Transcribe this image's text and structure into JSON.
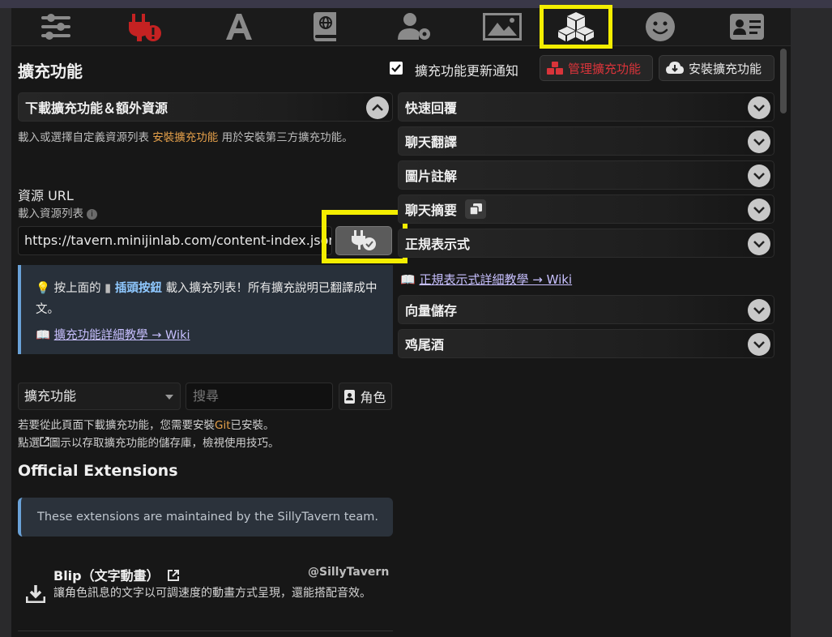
{
  "nav": {
    "icons": [
      "sliders-icon",
      "plug-error-icon",
      "font-a-icon",
      "book-globe-icon",
      "user-gear-icon",
      "image-icon",
      "cubes-icon",
      "smiley-icon",
      "id-card-icon"
    ],
    "active": "cubes-icon"
  },
  "header": {
    "title": "擴充功能",
    "notify_label": "擴充功能更新通知",
    "manage_label": "管理擴充功能",
    "install_label": "安裝擴充功能"
  },
  "download": {
    "title": "下載擴充功能＆額外資源",
    "desc_before": "載入或選擇自定義資源列表",
    "desc_link": "安裝擴充功能",
    "desc_after": "用於安裝第三方擴充功能。",
    "url_label": "資源 URL",
    "list_label": "載入資源列表",
    "url_value": "https://tavern.minijinlab.com/content-index.json"
  },
  "info": {
    "line_a": "按上面的",
    "line_b": "插頭按鈕",
    "line_c": "載入擴充列表！所有擴充說明已翻譯成中文。",
    "wiki": "擴充功能詳細教學 → Wiki"
  },
  "filter": {
    "select_value": "擴充功能",
    "search_placeholder": "搜尋",
    "role_label": "角色"
  },
  "note": {
    "l1a": "若要從此頁面下載擴充功能，您需要安裝",
    "git": "Git",
    "l1b": "已安裝。",
    "l2a": "點選",
    "l2b": "圖示以存取擴充功能的儲存庫，檢視使用技巧。"
  },
  "official": {
    "title": "Official Extensions",
    "notice": "These extensions are maintained by the SillyTavern team.",
    "ext": {
      "name": "Blip（文字動畫）",
      "author": "@SillyTavern",
      "desc": "讓角色訊息的文字以可調速度的動畫方式呈現，還能搭配音效。"
    }
  },
  "right": {
    "d1": "快速回覆",
    "d2": "聊天翻譯",
    "d3": "圖片註解",
    "d4": "聊天摘要",
    "d5": "正規表示式",
    "regex_link": "正規表示式詳細教學 → Wiki",
    "d6": "向量儲存",
    "d7": "鸡尾酒"
  }
}
